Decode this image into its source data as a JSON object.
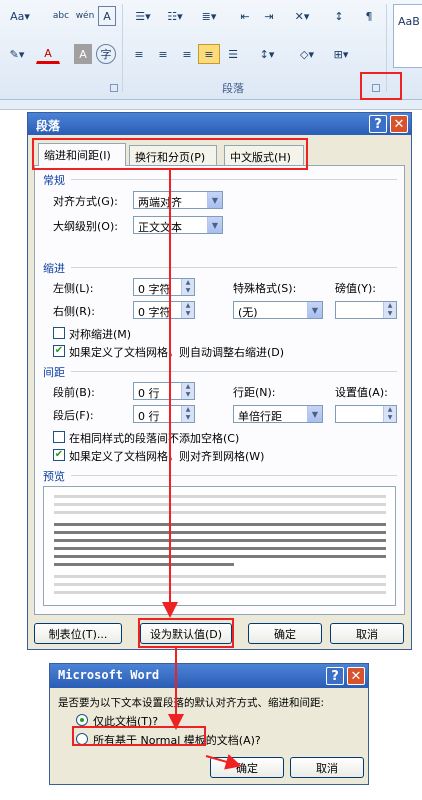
{
  "ribbon": {
    "font_grow": "Aa",
    "abc": "abc",
    "wen": "wén",
    "char_box": "A",
    "font_color": "A",
    "shade_a": "A",
    "enclose": "字",
    "style_preview": "AaB",
    "group_label": "段落"
  },
  "para_dialog": {
    "title": "段落",
    "help": "?",
    "close": "✕",
    "tabs": [
      "缩进和间距(I)",
      "换行和分页(P)",
      "中文版式(H)"
    ],
    "general": {
      "header": "常规",
      "align_label": "对齐方式(G):",
      "align_value": "两端对齐",
      "outline_label": "大纲级别(O):",
      "outline_value": "正文文本"
    },
    "indent": {
      "header": "缩进",
      "left_label": "左侧(L):",
      "left_value": "0 字符",
      "right_label": "右侧(R):",
      "right_value": "0 字符",
      "special_label": "特殊格式(S):",
      "special_value": "(无)",
      "by_label": "磅值(Y):",
      "mirror_label": "对称缩进(M)",
      "grid_adjust_label": "如果定义了文档网格，则自动调整右缩进(D)"
    },
    "spacing": {
      "header": "间距",
      "before_label": "段前(B):",
      "before_value": "0 行",
      "after_label": "段后(F):",
      "after_value": "0 行",
      "line_label": "行距(N):",
      "line_value": "单倍行距",
      "at_label": "设置值(A):",
      "no_space_label": "在相同样式的段落间不添加空格(C)",
      "snap_grid_label": "如果定义了文档网格，则对齐到网格(W)"
    },
    "preview_header": "预览",
    "buttons": {
      "tabs": "制表位(T)...",
      "default": "设为默认值(D)",
      "ok": "确定",
      "cancel": "取消"
    }
  },
  "confirm_dialog": {
    "title": "Microsoft Word",
    "help": "?",
    "close": "✕",
    "question": "是否要为以下文本设置段落的默认对齐方式、缩进和间距:",
    "option_this": "仅此文档(T)?",
    "option_all": "所有基于 Normal 模板的文档(A)?",
    "ok": "确定",
    "cancel": "取消"
  },
  "colors": {
    "highlight": "#ee2222",
    "title_blue": "#2a5db5",
    "dialog_bg": "#ece9d8",
    "section_blue": "#0c3fa5",
    "check_green": "#21a121"
  }
}
